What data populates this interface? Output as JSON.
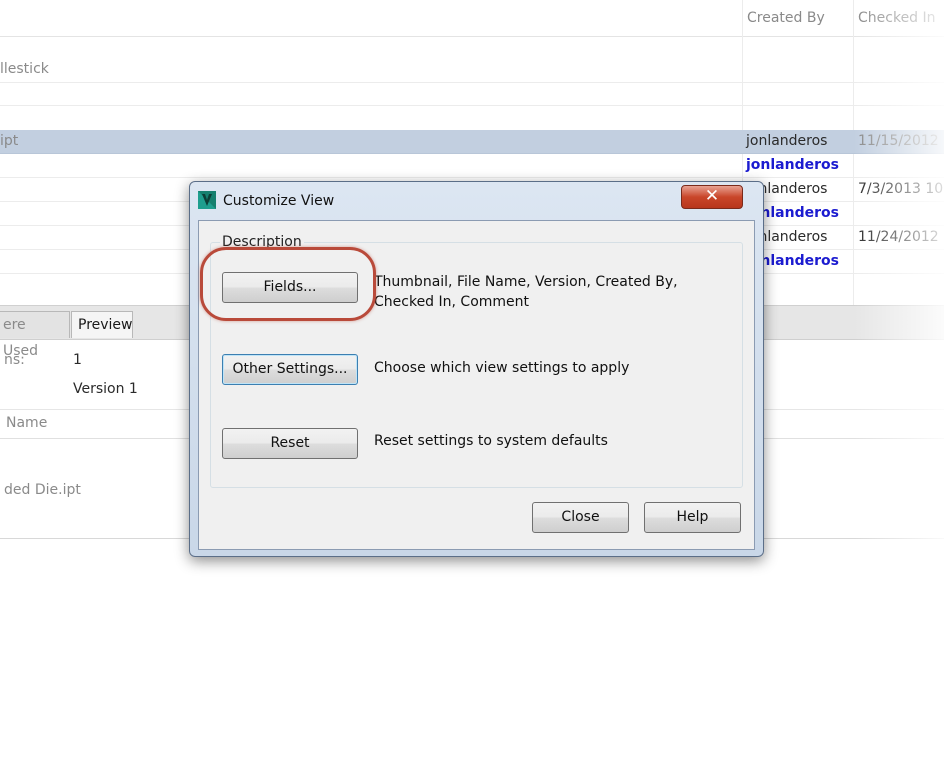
{
  "grid": {
    "columns": {
      "created_by": "Created By",
      "checked_in": "Checked In"
    },
    "rows": [
      {
        "name": "llestick",
        "created_by": "",
        "checked_in": "",
        "style": "normal"
      },
      {
        "name": "",
        "created_by": "",
        "checked_in": "",
        "style": "normal"
      },
      {
        "name": "ipt",
        "created_by": "jonlanderos",
        "checked_in": "11/15/2012",
        "style": "selected"
      },
      {
        "name": "",
        "created_by": "jonlanderos",
        "checked_in": "",
        "style": "bold"
      },
      {
        "name": "",
        "created_by": "jonlanderos",
        "checked_in": "7/3/2013 10",
        "style": "normal"
      },
      {
        "name": "",
        "created_by": "jonlanderos",
        "checked_in": "",
        "style": "bold"
      },
      {
        "name": "",
        "created_by": "jonlanderos",
        "checked_in": "11/24/2012",
        "style": "normal"
      },
      {
        "name": "",
        "created_by": "jonlanderos",
        "checked_in": "",
        "style": "bold"
      }
    ]
  },
  "tabs": {
    "where_used": "ere Used",
    "preview": "Preview"
  },
  "properties": {
    "label1": "ns:",
    "value1": "1",
    "value2": "Version 1"
  },
  "lower_table": {
    "header": "Name",
    "row": "ded Die.ipt"
  },
  "dialog": {
    "title": "Customize View",
    "close_glyph": "✕",
    "group_label": "Description",
    "fields_button": "Fields...",
    "fields_desc": "Thumbnail, File Name, Version, Created By, Checked In, Comment",
    "other_settings_button": "Other Settings...",
    "other_settings_desc": "Choose which view settings to apply",
    "reset_button": "Reset",
    "reset_desc": "Reset settings to system defaults",
    "close_button": "Close",
    "help_button": "Help"
  },
  "colors": {
    "selection": "#c2cfe0",
    "link_blue": "#1b1bd0",
    "highlight_ring": "#b94a3a",
    "app_icon": "#1f9e8e"
  },
  "icons": {
    "app": "autodesk-vault-icon",
    "close": "close-icon"
  }
}
